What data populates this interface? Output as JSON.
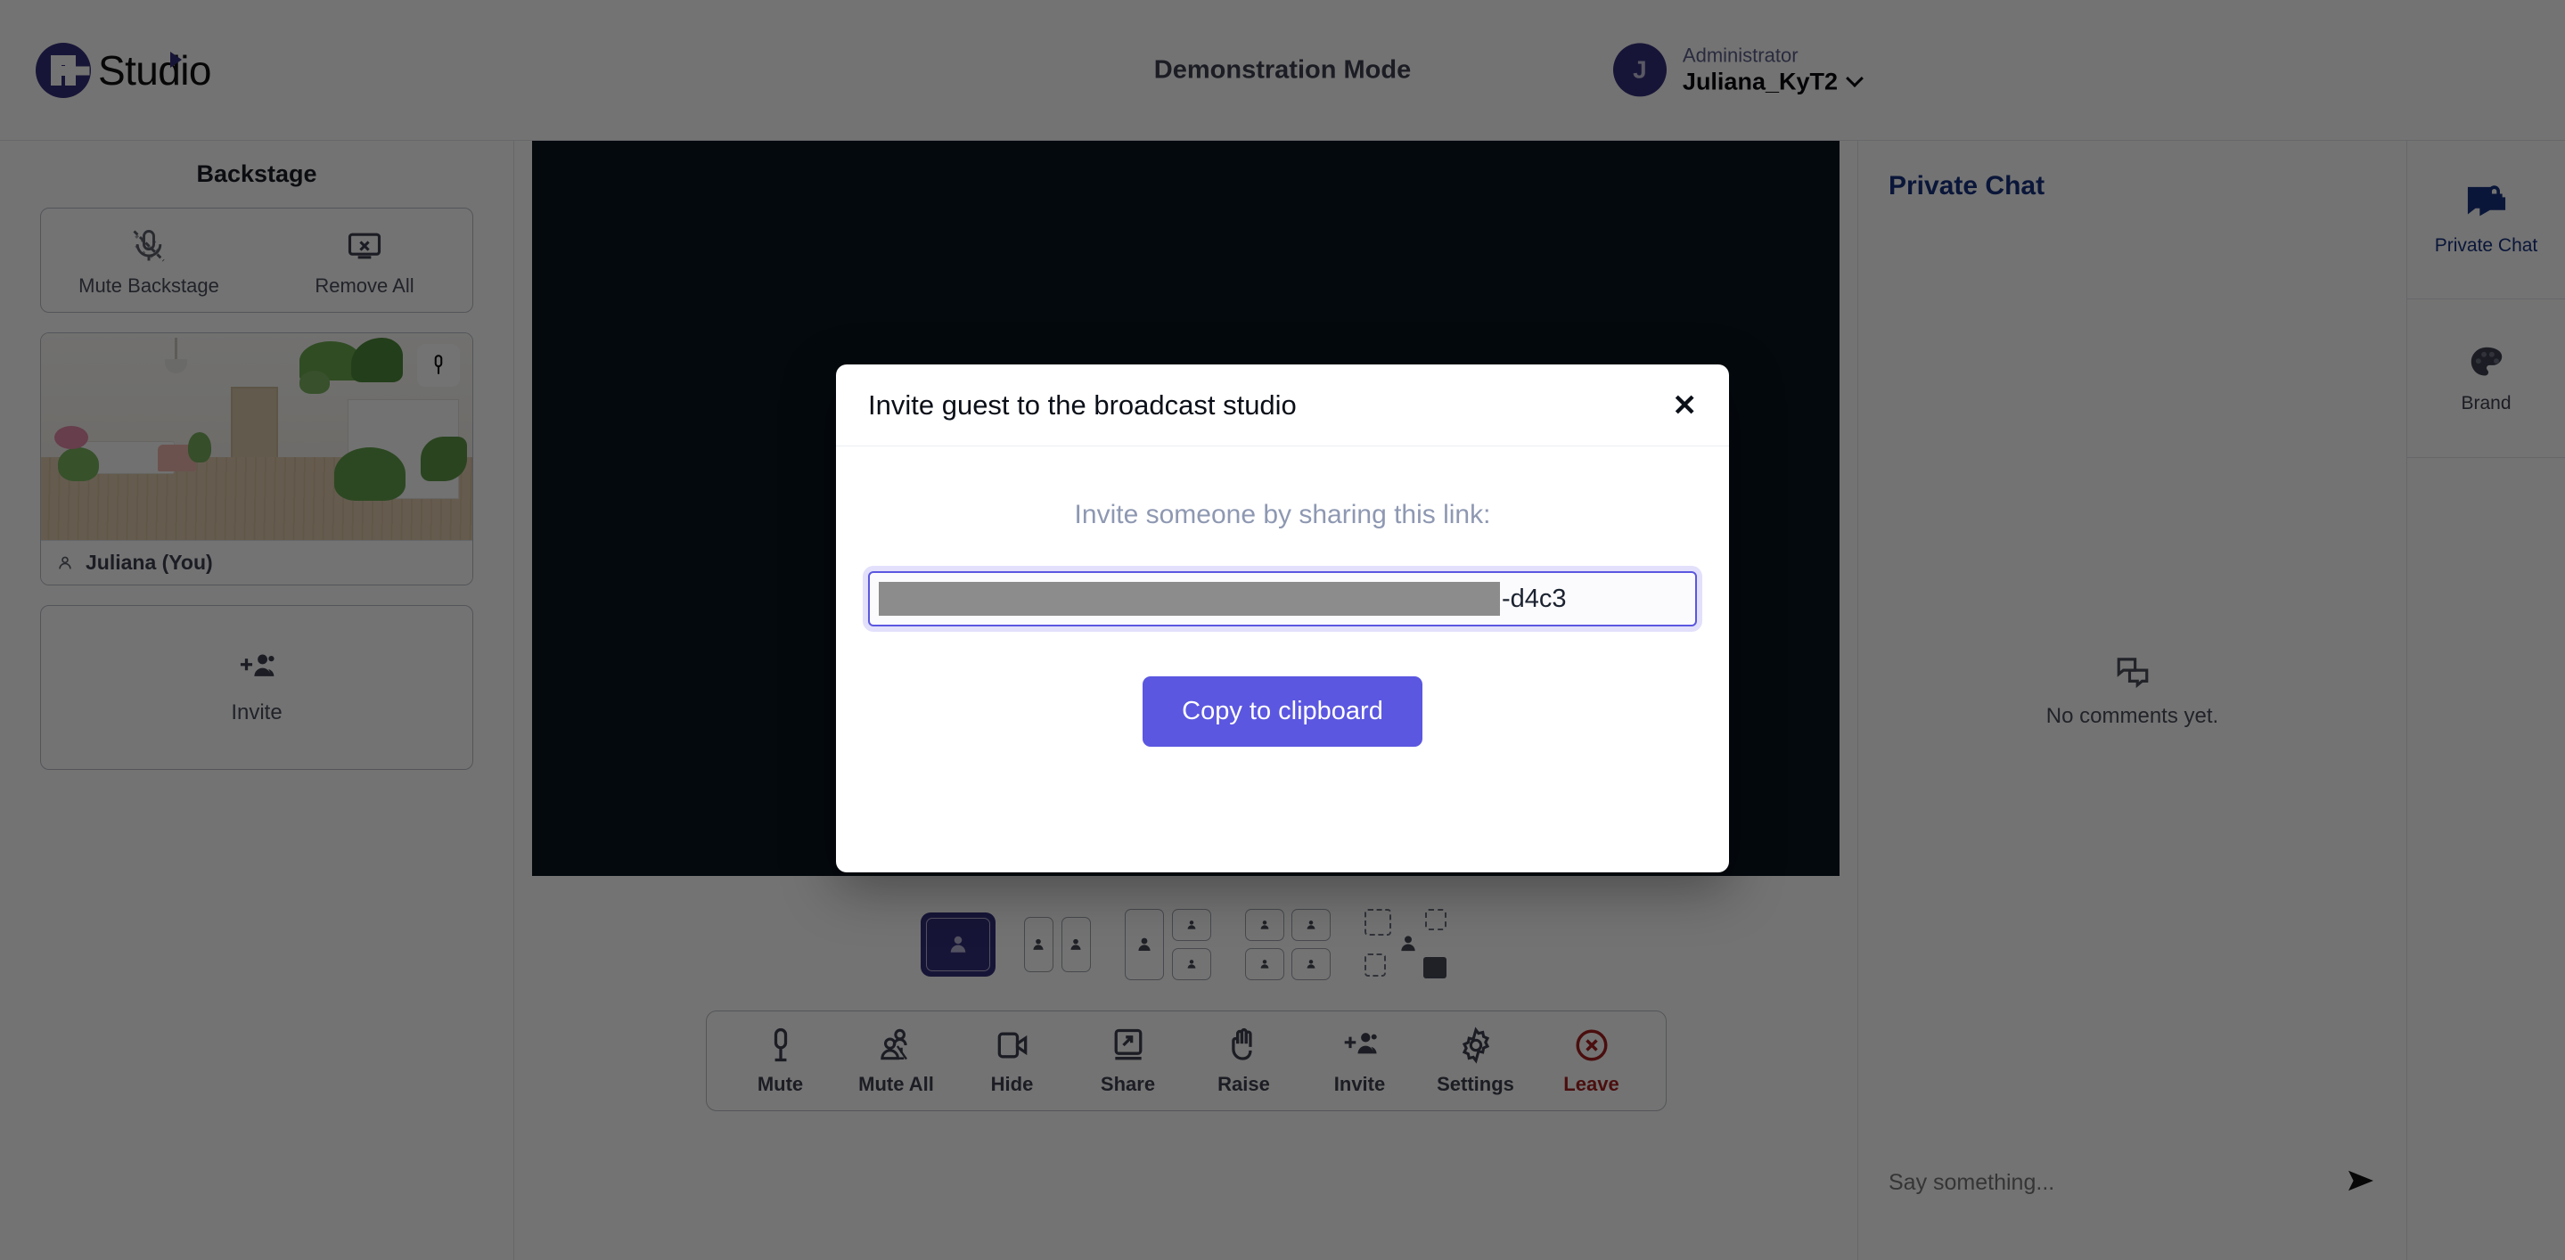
{
  "topbar": {
    "brand": "Studio",
    "mode_label": "Demonstration Mode",
    "user": {
      "initial": "J",
      "role": "Administrator",
      "name": "Juliana_KyT2"
    }
  },
  "sidebar": {
    "title": "Backstage",
    "actions": [
      {
        "label": "Mute Backstage",
        "icon": "mic-off-icon"
      },
      {
        "label": "Remove All",
        "icon": "screen-remove-icon"
      }
    ],
    "participant": {
      "name": "Juliana (You)",
      "mic_icon": "microphone-icon"
    },
    "invite": {
      "label": "Invite",
      "icon": "add-person-icon"
    }
  },
  "stage": {
    "layouts": [
      {
        "name": "single-speaker",
        "selected": true
      },
      {
        "name": "two-columns",
        "selected": false
      },
      {
        "name": "one-plus-two",
        "selected": false
      },
      {
        "name": "grid-four",
        "selected": false
      },
      {
        "name": "custom-layout",
        "selected": false
      }
    ]
  },
  "toolbar": {
    "items": [
      {
        "label": "Mute",
        "icon": "microphone-icon",
        "danger": false
      },
      {
        "label": "Mute All",
        "icon": "mute-all-icon",
        "danger": false
      },
      {
        "label": "Hide",
        "icon": "camera-icon",
        "danger": false
      },
      {
        "label": "Share",
        "icon": "share-screen-icon",
        "danger": false
      },
      {
        "label": "Raise",
        "icon": "raise-hand-icon",
        "danger": false
      },
      {
        "label": "Invite",
        "icon": "add-person-icon",
        "danger": false
      },
      {
        "label": "Settings",
        "icon": "gear-icon",
        "danger": false
      },
      {
        "label": "Leave",
        "icon": "leave-call-icon",
        "danger": true
      }
    ]
  },
  "chat": {
    "title": "Private Chat",
    "empty_text": "No comments yet.",
    "empty_icon": "comments-icon",
    "input_placeholder": "Say something...",
    "input_value": "",
    "send_icon": "send-icon"
  },
  "rail": {
    "items": [
      {
        "label": "Private Chat",
        "icon": "private-chat-lock-icon",
        "active": true
      },
      {
        "label": "Brand",
        "icon": "palette-icon",
        "active": false
      }
    ]
  },
  "modal": {
    "title": "Invite guest to the broadcast studio",
    "close_label": "✕",
    "subtitle": "Invite someone by sharing this link:",
    "link_redacted": true,
    "link_tail": "-d4c3",
    "copy_label": "Copy to clipboard"
  },
  "colors": {
    "brand_purple": "#332f7a",
    "accent_button": "#5b57e0",
    "chat_title_blue": "#17317f",
    "danger_red": "#a51f1f",
    "stage_navy": "#0a1521"
  }
}
